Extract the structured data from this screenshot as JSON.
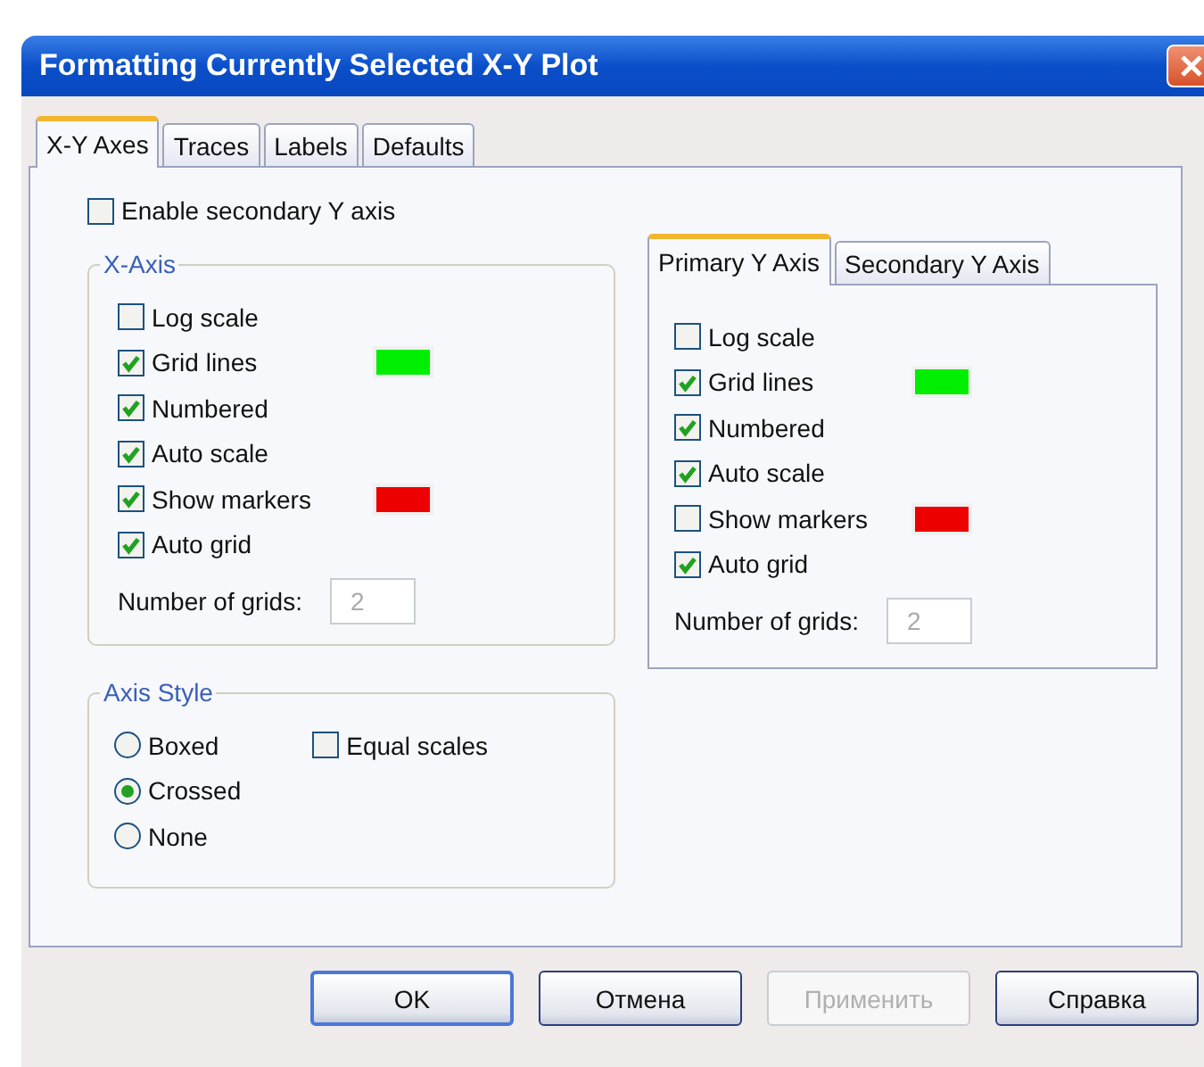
{
  "window": {
    "title": "Formatting Currently Selected X-Y Plot"
  },
  "tabs": [
    {
      "label": "X-Y Axes",
      "selected": true
    },
    {
      "label": "Traces",
      "selected": false
    },
    {
      "label": "Labels",
      "selected": false
    },
    {
      "label": "Defaults",
      "selected": false
    }
  ],
  "enable_secondary_y": {
    "label": "Enable secondary Y axis",
    "checked": false
  },
  "x_axis": {
    "title": "X-Axis",
    "options": [
      {
        "label": "Log scale",
        "checked": false
      },
      {
        "label": "Grid lines",
        "checked": true,
        "color": "#00ee00"
      },
      {
        "label": "Numbered",
        "checked": true
      },
      {
        "label": "Auto scale",
        "checked": true
      },
      {
        "label": "Show markers",
        "checked": true,
        "color": "#ee0000"
      },
      {
        "label": "Auto grid",
        "checked": true
      }
    ],
    "grids": {
      "label": "Number of grids:",
      "value": "2",
      "disabled": true
    }
  },
  "y_axis_tabs": [
    {
      "label": "Primary Y Axis",
      "selected": true
    },
    {
      "label": "Secondary Y Axis",
      "selected": false
    }
  ],
  "y_axis": {
    "options": [
      {
        "label": "Log scale",
        "checked": false
      },
      {
        "label": "Grid lines",
        "checked": true,
        "color": "#00ee00"
      },
      {
        "label": "Numbered",
        "checked": true
      },
      {
        "label": "Auto scale",
        "checked": true
      },
      {
        "label": "Show markers",
        "checked": false,
        "color": "#ee0000"
      },
      {
        "label": "Auto grid",
        "checked": true
      }
    ],
    "grids": {
      "label": "Number of grids:",
      "value": "2",
      "disabled": true
    }
  },
  "axis_style": {
    "title": "Axis Style",
    "options": [
      {
        "label": "Boxed",
        "selected": false
      },
      {
        "label": "Crossed",
        "selected": true
      },
      {
        "label": "None",
        "selected": false
      }
    ],
    "equal_scales": {
      "label": "Equal scales",
      "checked": false
    }
  },
  "buttons": [
    {
      "label": "OK",
      "default": true,
      "disabled": false
    },
    {
      "label": "Отмена",
      "default": false,
      "disabled": false
    },
    {
      "label": "Применить",
      "default": false,
      "disabled": true
    },
    {
      "label": "Справка",
      "default": false,
      "disabled": false
    }
  ]
}
